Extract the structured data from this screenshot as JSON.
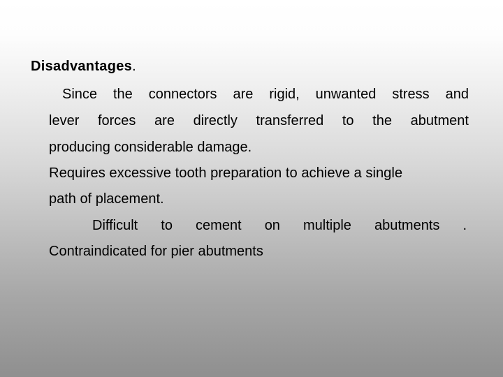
{
  "slide": {
    "title": "Disadvantages",
    "title_period": ".",
    "paragraphs": [
      {
        "lines": [
          [
            "Since",
            "the",
            "connectors",
            "are",
            "rigid,",
            "unwanted",
            "stress",
            "and"
          ],
          [
            "lever",
            "forces",
            "are",
            "directly",
            "transferred",
            "to",
            "the",
            "abutment"
          ],
          "producing considerable damage."
        ]
      },
      {
        "lines": [
          "Requires excessive tooth preparation to achieve a single",
          "path of placement."
        ]
      },
      {
        "lines": [
          [
            "Difficult",
            "to",
            "cement",
            "on",
            "multiple",
            "abutments",
            "."
          ],
          "Contraindicated for pier abutments"
        ]
      }
    ]
  }
}
